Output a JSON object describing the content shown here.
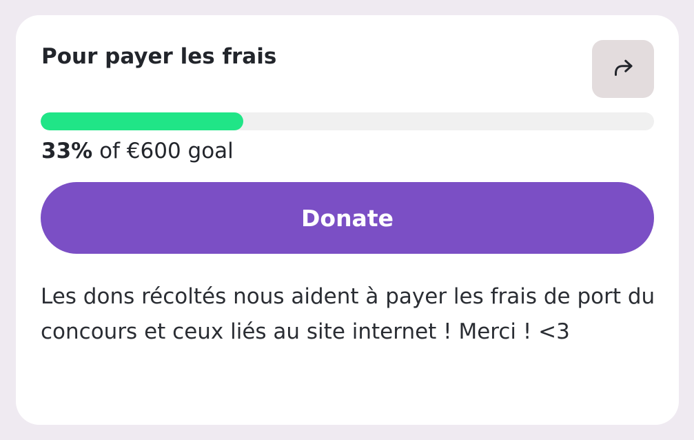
{
  "card": {
    "title": "Pour payer les frais",
    "share_icon": "share-arrow-icon"
  },
  "progress": {
    "percent": 33,
    "percent_label": "33%",
    "goal_suffix": "of €600 goal",
    "fill_color": "#20e587",
    "track_color": "#f0f0f0"
  },
  "donate": {
    "label": "Donate",
    "color": "#7b4fc5"
  },
  "description": {
    "text": "Les dons récoltés nous aident à payer les frais de port du concours et ceux liés au site internet ! Merci ! <3"
  }
}
